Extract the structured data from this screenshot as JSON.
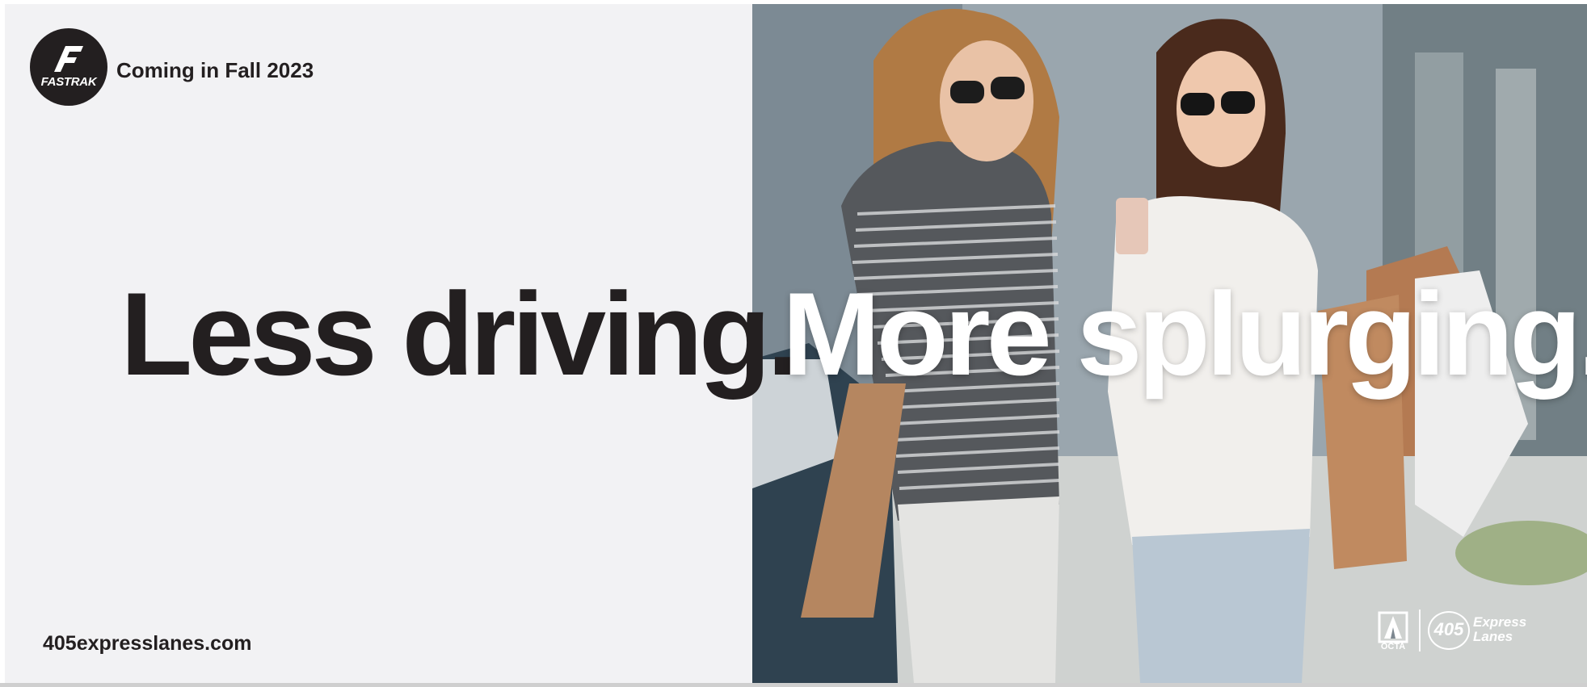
{
  "logo": {
    "icon": "fastrak-logo",
    "wordmark": "FASTRAK"
  },
  "tagline": "Coming in Fall 2023",
  "headline": {
    "dark": "Less driving.",
    "light": "More splurging."
  },
  "website": "405expresslanes.com",
  "partners": {
    "octa": "OCTA",
    "route_number": "405",
    "lanes_word1": "Express",
    "lanes_word2": "Lanes"
  },
  "photo": {
    "icon": "shopping-friends-photo"
  },
  "colors": {
    "background": "#f2f2f4",
    "text_dark": "#231f20",
    "text_light": "#ffffff"
  }
}
